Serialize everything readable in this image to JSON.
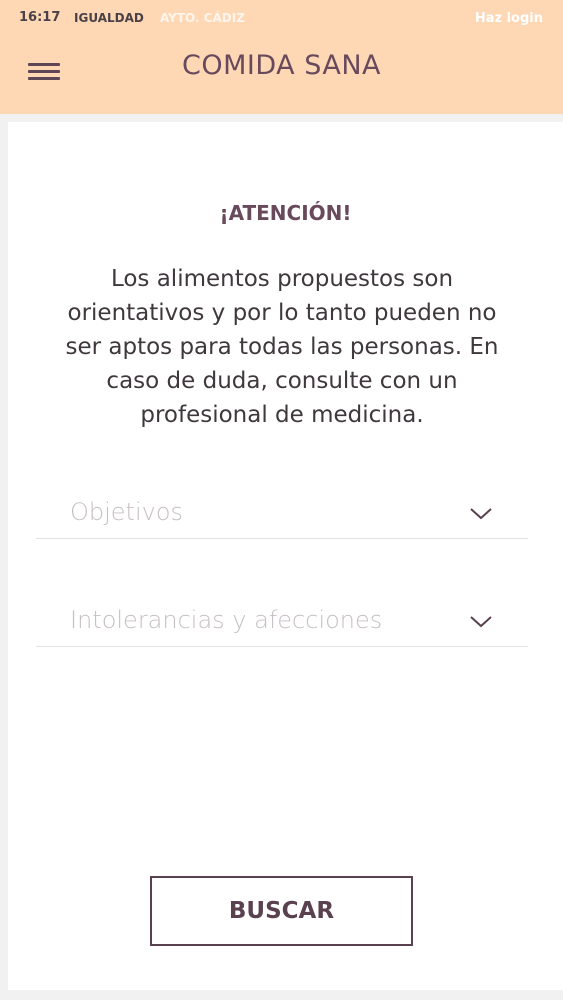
{
  "status_bar": {
    "time": "16:17",
    "carrier_left": "IGUALDAD",
    "carrier_right": "AYTO. CÁDIZ",
    "login": "Haz login"
  },
  "header": {
    "title": "COMIDA SANA",
    "menu_icon": "hamburger-menu-icon",
    "background_color": "#fed8b5",
    "text_color": "#684a5c"
  },
  "notice": {
    "title": "¡ATENCIÓN!",
    "text": "Los alimentos propuestos son orientativos y por lo tanto pueden no ser aptos para todas las personas. En caso de duda, consulte con un profesional de medicina."
  },
  "filters": {
    "objetivos_label": "Objetivos",
    "intolerancias_label": "Intolerancias y afecciones",
    "chevron_icon": "chevron-down-icon"
  },
  "actions": {
    "search_label": "BUSCAR"
  }
}
